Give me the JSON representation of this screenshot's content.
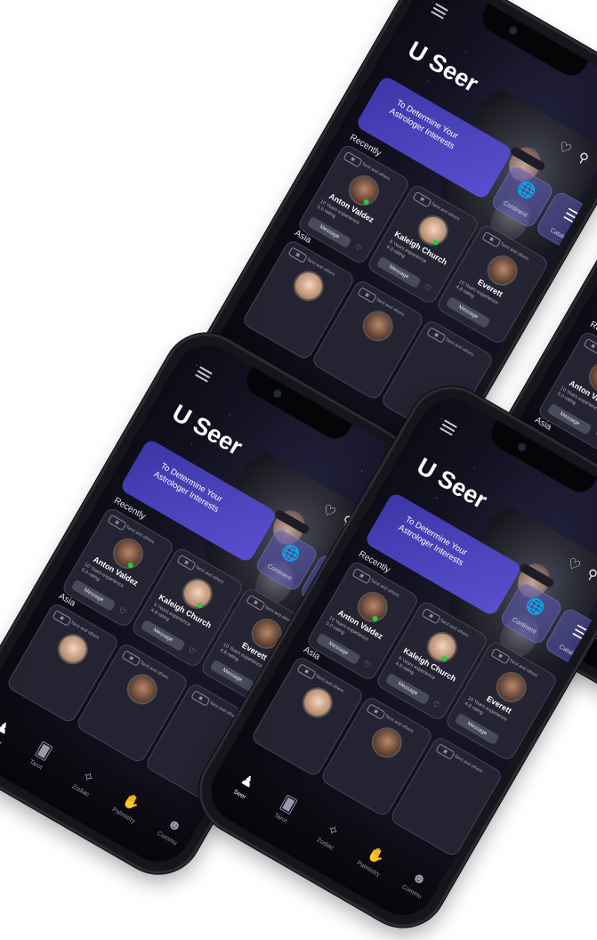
{
  "app": {
    "title": "U Seer",
    "banner": "To Determine Your Astrologer Interests",
    "tiles": [
      {
        "label": "Continent",
        "icon": "globe-icon"
      },
      {
        "label": "Catalog",
        "icon": "catalog-stack-icon"
      }
    ],
    "sections": {
      "recently": "Recently",
      "asia": "Asia"
    },
    "tag": "Tarot and others",
    "cards": [
      {
        "name": "Anton Valdez",
        "experience": "10 Years experience",
        "rating": "5.0 rating",
        "button": "Message"
      },
      {
        "name": "Kaleigh Church",
        "experience": "6 Years experience",
        "rating": "4.9 rating",
        "button": "Message"
      },
      {
        "name": "Everett",
        "experience": "10 Years experience",
        "rating": "4.8 rating",
        "button": "Message"
      }
    ],
    "tabs": [
      {
        "label": "Seer",
        "icon": "seer-figure-icon",
        "active": true
      },
      {
        "label": "Tarot",
        "icon": "tarot-cards-icon",
        "active": false
      },
      {
        "label": "Zodiac",
        "icon": "zodiac-icon",
        "active": false
      },
      {
        "label": "Palmistry",
        "icon": "palm-icon",
        "active": false
      },
      {
        "label": "Commu",
        "icon": "community-icon",
        "active": false
      }
    ]
  },
  "colors": {
    "accent": "#4a41c0",
    "online": "#27c93f",
    "background": "#ffffff"
  }
}
